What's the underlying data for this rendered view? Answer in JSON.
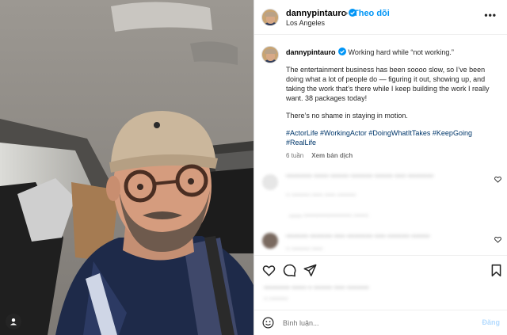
{
  "post": {
    "username": "dannypintauro",
    "follow_label": "Theo dõi",
    "dot": "•",
    "more": "•••",
    "location": "Los Angeles"
  },
  "caption": {
    "username": "dannypintauro",
    "headline": "Working hard while “not working.”",
    "paragraph1": "The entertainment business has been soooo slow, so I’ve been doing what a lot of people do — figuring it out, showing up, and taking the work that’s there while I keep building the work I really want. 38 packages today!",
    "paragraph2": "There’s no shame in staying in motion.",
    "hashtags": "#ActorLife #WorkingActor #DoingWhatItTakes #KeepGoing #RealLife",
    "time": "6 tuần",
    "translate_label": "Xem bản dịch"
  },
  "comments_blurred": [
    {
      "line1": "~~~~~~~ ~~~~ ~~~~~ ~~~~~~ ~~~~~ ~~~ ~~~~~~~",
      "line2": "~ ~~~~~ ~~~ ~~~ ~~~~~"
    },
    {
      "line1": "—— ~~~~~~~~~~~~~ ~~~~",
      "line2": ""
    },
    {
      "line1": "~~~~~~ ~~~~~~ ~~~ ~~~~~~~ ~~~ ~~~~~~ ~~~~~",
      "line2": "~ ~~~~~ ~~~"
    }
  ],
  "liked_by_blurred": {
    "line1": "~~~~~~~ ~~~~ ~ ~~~~~ ~~~ ~~~~~~",
    "line2": "~ ~~~~~"
  },
  "comment_box": {
    "placeholder": "Bình luận...",
    "post_label": "Đăng"
  },
  "colors": {
    "link_blue": "#0095f6",
    "hashtag": "#00376b",
    "verified": "#0095f6",
    "post_disabled": "#b3dbff"
  },
  "icons": [
    "verified-badge-icon",
    "more-options-icon",
    "heart-icon",
    "comment-icon",
    "share-icon",
    "bookmark-icon",
    "emoji-icon",
    "user-tag-icon"
  ]
}
